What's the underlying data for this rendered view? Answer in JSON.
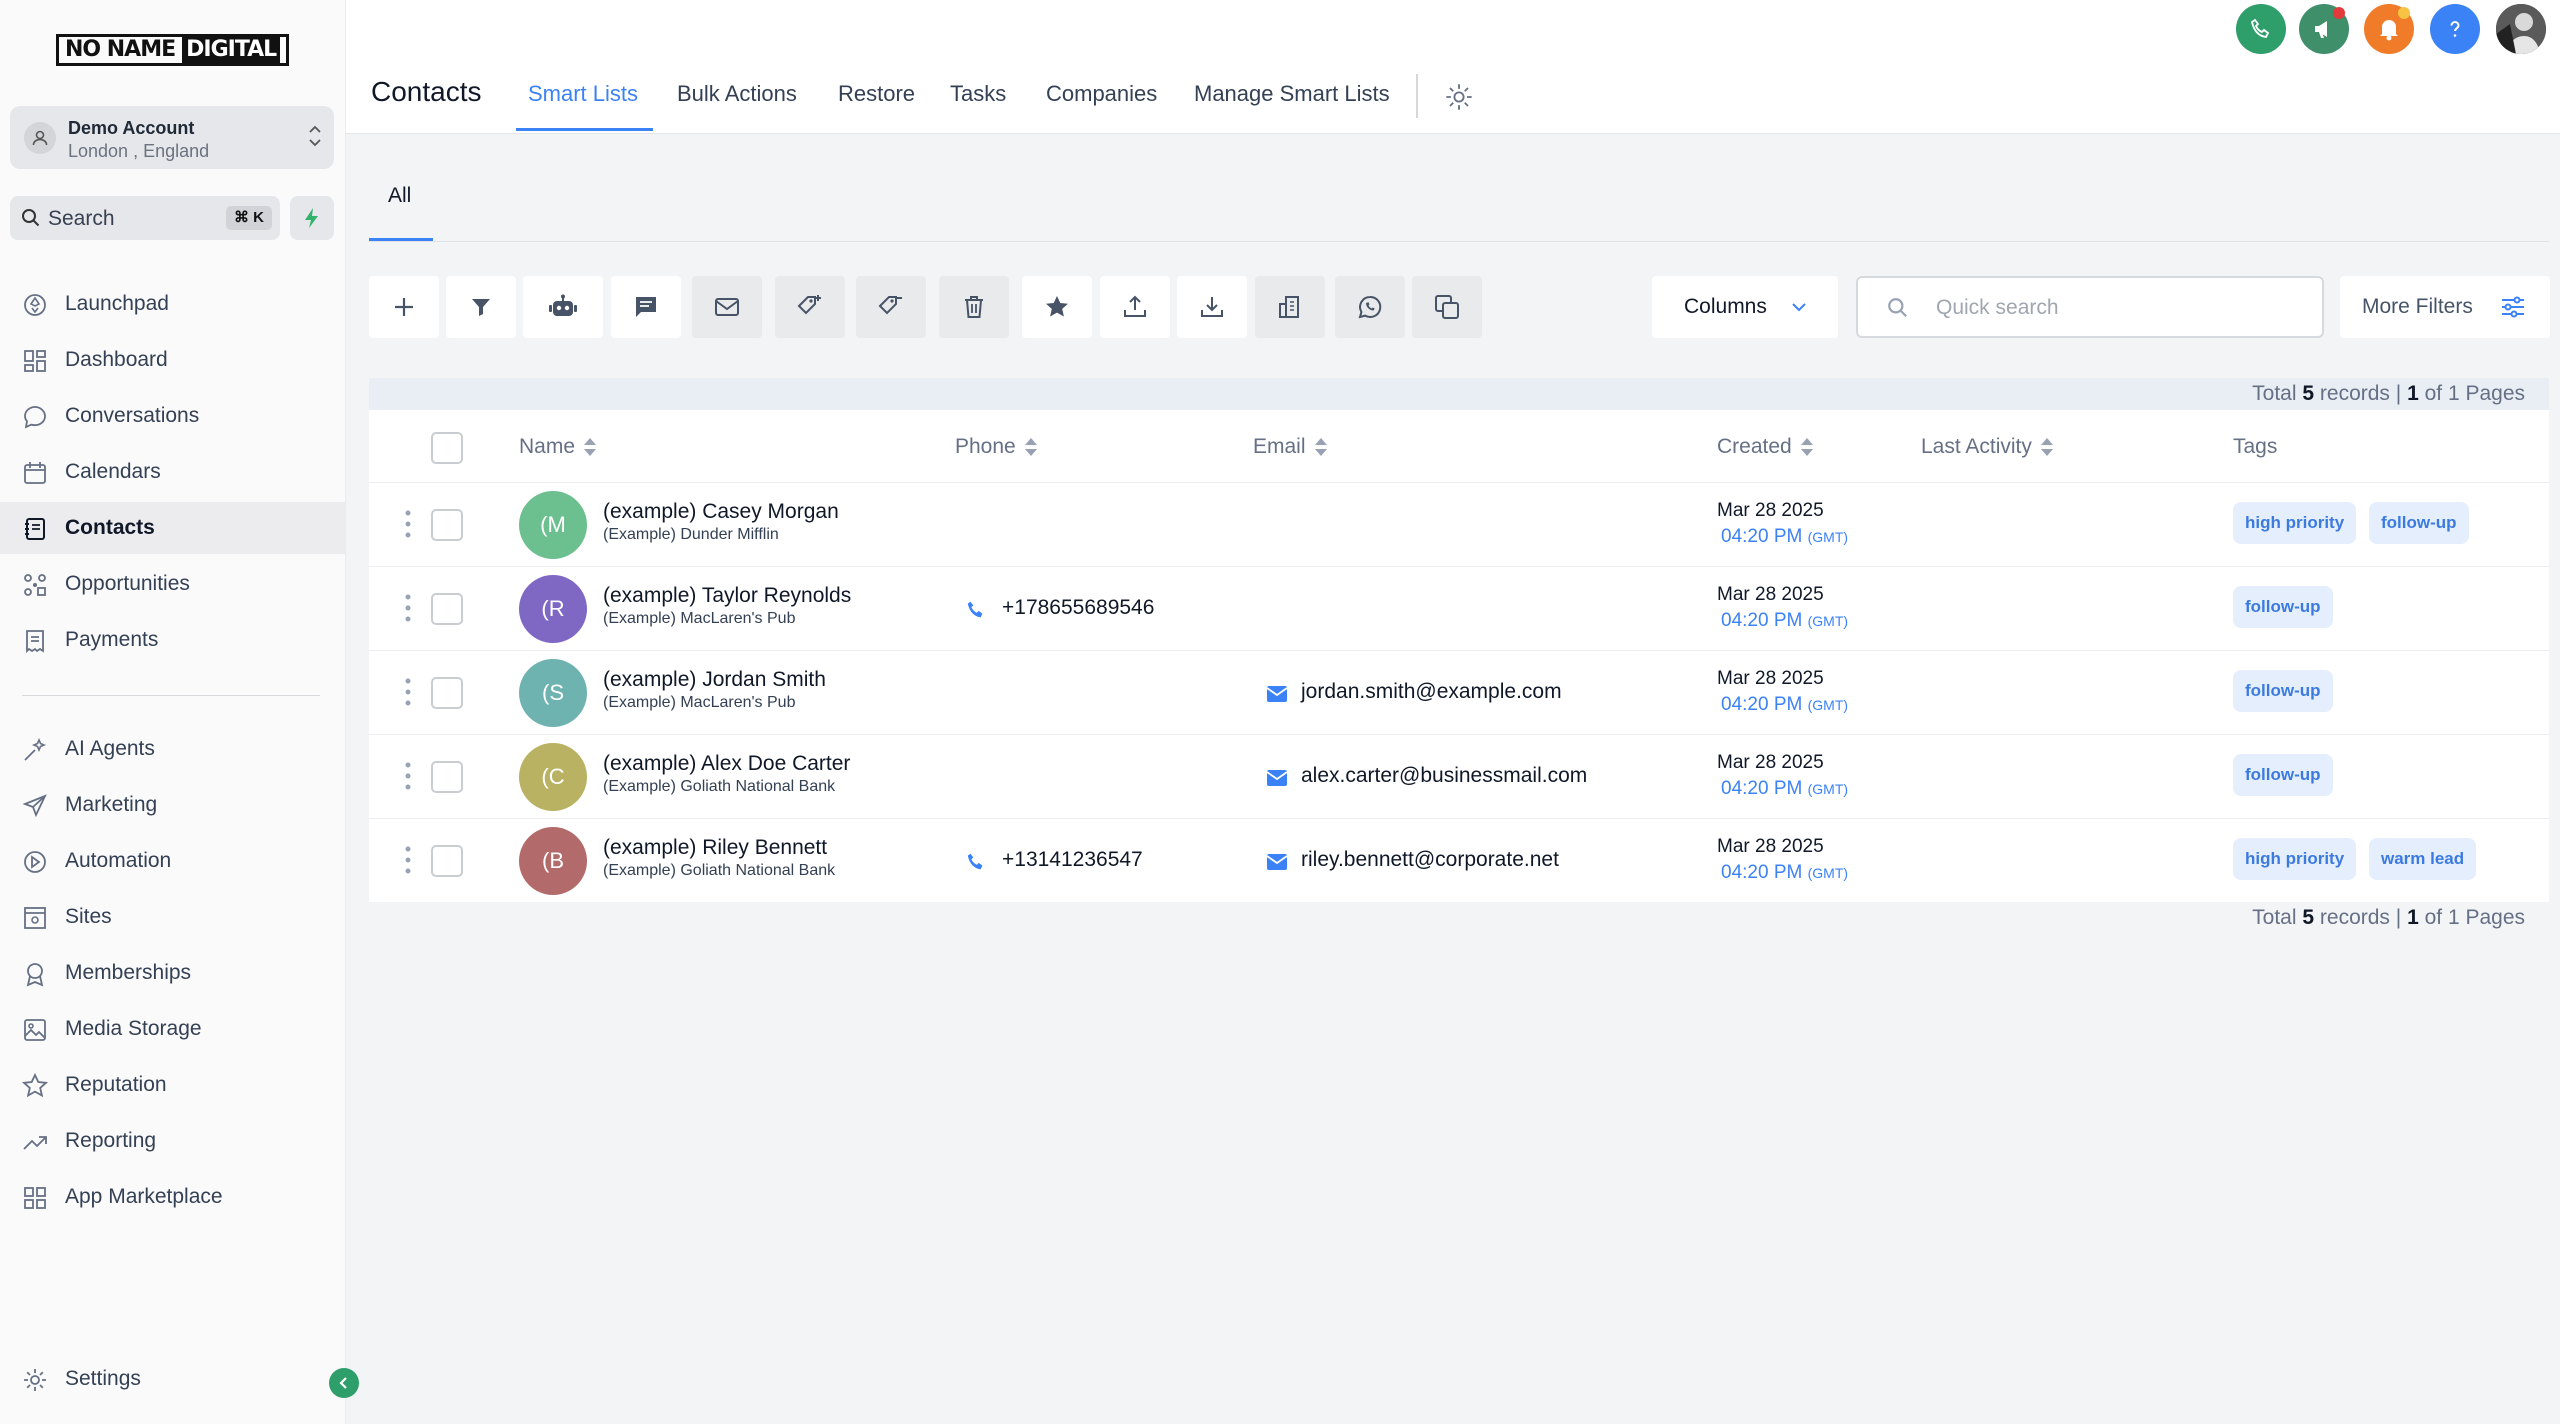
{
  "brand": {
    "logo_left": "NO NAME",
    "logo_right": "DIGITAL"
  },
  "account": {
    "name": "Demo Account",
    "location": "London , England"
  },
  "search": {
    "label": "Search",
    "shortcut": "⌘ K"
  },
  "nav": {
    "items": [
      {
        "label": "Launchpad",
        "icon": "launchpad-icon"
      },
      {
        "label": "Dashboard",
        "icon": "dashboard-icon"
      },
      {
        "label": "Conversations",
        "icon": "chat-icon"
      },
      {
        "label": "Calendars",
        "icon": "calendar-icon"
      },
      {
        "label": "Contacts",
        "icon": "contacts-icon",
        "active": true
      },
      {
        "label": "Opportunities",
        "icon": "opportunities-icon"
      },
      {
        "label": "Payments",
        "icon": "payments-icon"
      }
    ],
    "items2": [
      {
        "label": "AI Agents",
        "icon": "ai-sparkle-icon"
      },
      {
        "label": "Marketing",
        "icon": "send-icon"
      },
      {
        "label": "Automation",
        "icon": "automation-icon"
      },
      {
        "label": "Sites",
        "icon": "sites-icon"
      },
      {
        "label": "Memberships",
        "icon": "award-icon"
      },
      {
        "label": "Media Storage",
        "icon": "image-icon"
      },
      {
        "label": "Reputation",
        "icon": "star-icon"
      },
      {
        "label": "Reporting",
        "icon": "trend-icon"
      },
      {
        "label": "App Marketplace",
        "icon": "grid-icon"
      }
    ],
    "settings": "Settings"
  },
  "header": {
    "title": "Contacts",
    "tabs": [
      "Smart Lists",
      "Bulk Actions",
      "Restore",
      "Tasks",
      "Companies",
      "Manage Smart Lists"
    ],
    "active_tab": "Smart Lists"
  },
  "subtabs": {
    "all": "All"
  },
  "toolbar": {
    "columns_label": "Columns",
    "quick_search_placeholder": "Quick search",
    "more_filters_label": "More Filters"
  },
  "colors": {
    "accent": "#3b82f6",
    "green": "#2e9e6b",
    "orange": "#f07c2a",
    "tag_bg": "#e5eefc"
  },
  "table": {
    "summary": {
      "prefix": "Total",
      "records": "5",
      "mid": "records |",
      "page": "1",
      "of": "of 1 Pages"
    },
    "headers": {
      "name": "Name",
      "phone": "Phone",
      "email": "Email",
      "created": "Created",
      "last_activity": "Last Activity",
      "tags": "Tags"
    },
    "rows": [
      {
        "initials": "(M",
        "avatar_color": "#6cbf8e",
        "name": "(example) Casey Morgan",
        "company": "(Example) Dunder Mifflin",
        "phone": "",
        "email": "",
        "date": "Mar 28 2025",
        "time": "04:20 PM",
        "tz": "(GMT)",
        "tags": [
          "high priority",
          "follow-up"
        ]
      },
      {
        "initials": "(R",
        "avatar_color": "#7f67c4",
        "name": "(example) Taylor Reynolds",
        "company": "(Example) MacLaren's Pub",
        "phone": "+178655689546",
        "email": "",
        "date": "Mar 28 2025",
        "time": "04:20 PM",
        "tz": "(GMT)",
        "tags": [
          "follow-up"
        ]
      },
      {
        "initials": "(S",
        "avatar_color": "#6fb3b0",
        "name": "(example) Jordan Smith",
        "company": "(Example) MacLaren's Pub",
        "phone": "",
        "email": "jordan.smith@example.com",
        "date": "Mar 28 2025",
        "time": "04:20 PM",
        "tz": "(GMT)",
        "tags": [
          "follow-up"
        ]
      },
      {
        "initials": "(C",
        "avatar_color": "#b9b262",
        "name": "(example) Alex Doe Carter",
        "company": "(Example) Goliath National Bank",
        "phone": "",
        "email": "alex.carter@businessmail.com",
        "date": "Mar 28 2025",
        "time": "04:20 PM",
        "tz": "(GMT)",
        "tags": [
          "follow-up"
        ]
      },
      {
        "initials": "(B",
        "avatar_color": "#b36a6a",
        "name": "(example) Riley Bennett",
        "company": "(Example) Goliath National Bank",
        "phone": "+13141236547",
        "email": "riley.bennett@corporate.net",
        "date": "Mar 28 2025",
        "time": "04:20 PM",
        "tz": "(GMT)",
        "tags": [
          "high priority",
          "warm lead"
        ]
      }
    ]
  }
}
